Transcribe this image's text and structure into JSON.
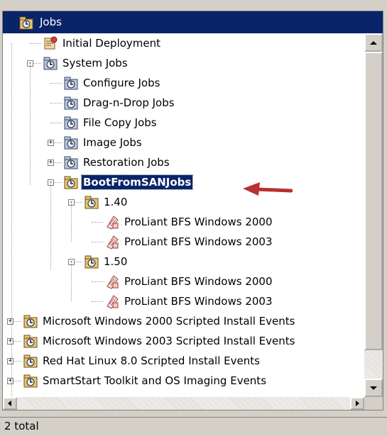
{
  "window": {
    "title": "Jobs"
  },
  "tree": [
    {
      "label": "Initial Deployment",
      "icon": "deployment-icon",
      "level": 1,
      "expander": null
    },
    {
      "label": "System Jobs",
      "icon": "folder-icon",
      "level": 1,
      "expander": "-"
    },
    {
      "label": "Configure Jobs",
      "icon": "folder-icon",
      "level": 2,
      "expander": null
    },
    {
      "label": "Drag-n-Drop Jobs",
      "icon": "folder-icon",
      "level": 2,
      "expander": null
    },
    {
      "label": "File Copy Jobs",
      "icon": "folder-icon",
      "level": 2,
      "expander": null
    },
    {
      "label": "Image Jobs",
      "icon": "folder-icon",
      "level": 2,
      "expander": "+"
    },
    {
      "label": "Restoration Jobs",
      "icon": "folder-icon",
      "level": 2,
      "expander": "+"
    },
    {
      "label": "BootFromSANJobs",
      "icon": "folder-yellow-icon",
      "level": 2,
      "expander": "-",
      "selected": true
    },
    {
      "label": "1.40",
      "icon": "folder-yellow-icon",
      "level": 3,
      "expander": "-"
    },
    {
      "label": "ProLiant BFS Windows 2000",
      "icon": "job-icon",
      "level": 4,
      "expander": null
    },
    {
      "label": "ProLiant BFS Windows 2003",
      "icon": "job-icon",
      "level": 4,
      "expander": null
    },
    {
      "label": "1.50",
      "icon": "folder-yellow-icon",
      "level": 3,
      "expander": "-"
    },
    {
      "label": "ProLiant BFS Windows 2000",
      "icon": "job-icon",
      "level": 4,
      "expander": null
    },
    {
      "label": "ProLiant BFS Windows 2003",
      "icon": "job-icon",
      "level": 4,
      "expander": null
    },
    {
      "label": "Microsoft Windows 2000 Scripted Install Events",
      "icon": "folder-yellow-icon",
      "level": 0,
      "expander": "+"
    },
    {
      "label": "Microsoft Windows 2003 Scripted Install Events",
      "icon": "folder-yellow-icon",
      "level": 0,
      "expander": "+"
    },
    {
      "label": "Red Hat Linux 8.0 Scripted Install Events",
      "icon": "folder-yellow-icon",
      "level": 0,
      "expander": "+"
    },
    {
      "label": "SmartStart Toolkit and OS Imaging Events",
      "icon": "folder-yellow-icon",
      "level": 0,
      "expander": "+"
    }
  ],
  "status": {
    "text": "2 total"
  },
  "colors": {
    "selection": "#0a246a",
    "arrow": "#c0392b"
  }
}
